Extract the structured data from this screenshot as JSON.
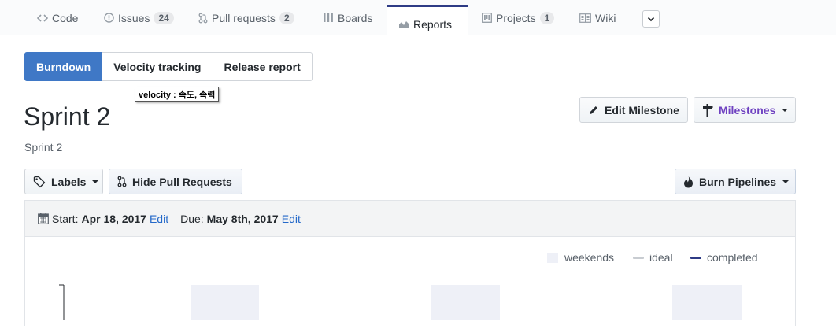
{
  "repo_nav": {
    "tabs": [
      {
        "label": "Code",
        "icon": "code-icon",
        "count": null,
        "selected": false
      },
      {
        "label": "Issues",
        "icon": "issue-opened-icon",
        "count": "24",
        "selected": false
      },
      {
        "label": "Pull requests",
        "icon": "git-pull-request-icon",
        "count": "2",
        "selected": false
      },
      {
        "label": "Boards",
        "icon": "boards-icon",
        "count": null,
        "selected": false
      },
      {
        "label": "Reports",
        "icon": "graph-icon",
        "count": null,
        "selected": true
      },
      {
        "label": "Projects",
        "icon": "project-icon",
        "count": "1",
        "selected": false
      },
      {
        "label": "Wiki",
        "icon": "book-icon",
        "count": null,
        "selected": false
      }
    ],
    "more_icon": "chevron-down-icon"
  },
  "report_tabs": [
    {
      "label": "Burndown",
      "active": true
    },
    {
      "label": "Velocity tracking",
      "active": false
    },
    {
      "label": "Release report",
      "active": false
    }
  ],
  "tooltip": "velocity : 속도, 속력",
  "milestone": {
    "title": "Sprint 2",
    "subtitle": "Sprint 2"
  },
  "actions": {
    "edit_milestone": "Edit Milestone",
    "milestones": "Milestones",
    "labels": "Labels",
    "hide_pull_requests": "Hide Pull Requests",
    "burn_pipelines": "Burn Pipelines"
  },
  "dates": {
    "start_label": "Start:",
    "start_value": "Apr 18, 2017",
    "start_edit": "Edit",
    "due_label": "Due:",
    "due_value": "May 8th, 2017",
    "due_edit": "Edit"
  },
  "chart_legend": [
    {
      "label": "weekends",
      "kind": "area"
    },
    {
      "label": "ideal",
      "kind": "line"
    },
    {
      "label": "completed",
      "kind": "line"
    }
  ],
  "colors": {
    "accent": "#3f78c6",
    "selected_tab_border": "#2e3b85",
    "milestones_text": "#6f42c1",
    "link": "#2469c9",
    "weekend_fill": "#eef0f7",
    "ideal_line": "#c8ccd1",
    "completed_line": "#2e3b85"
  }
}
